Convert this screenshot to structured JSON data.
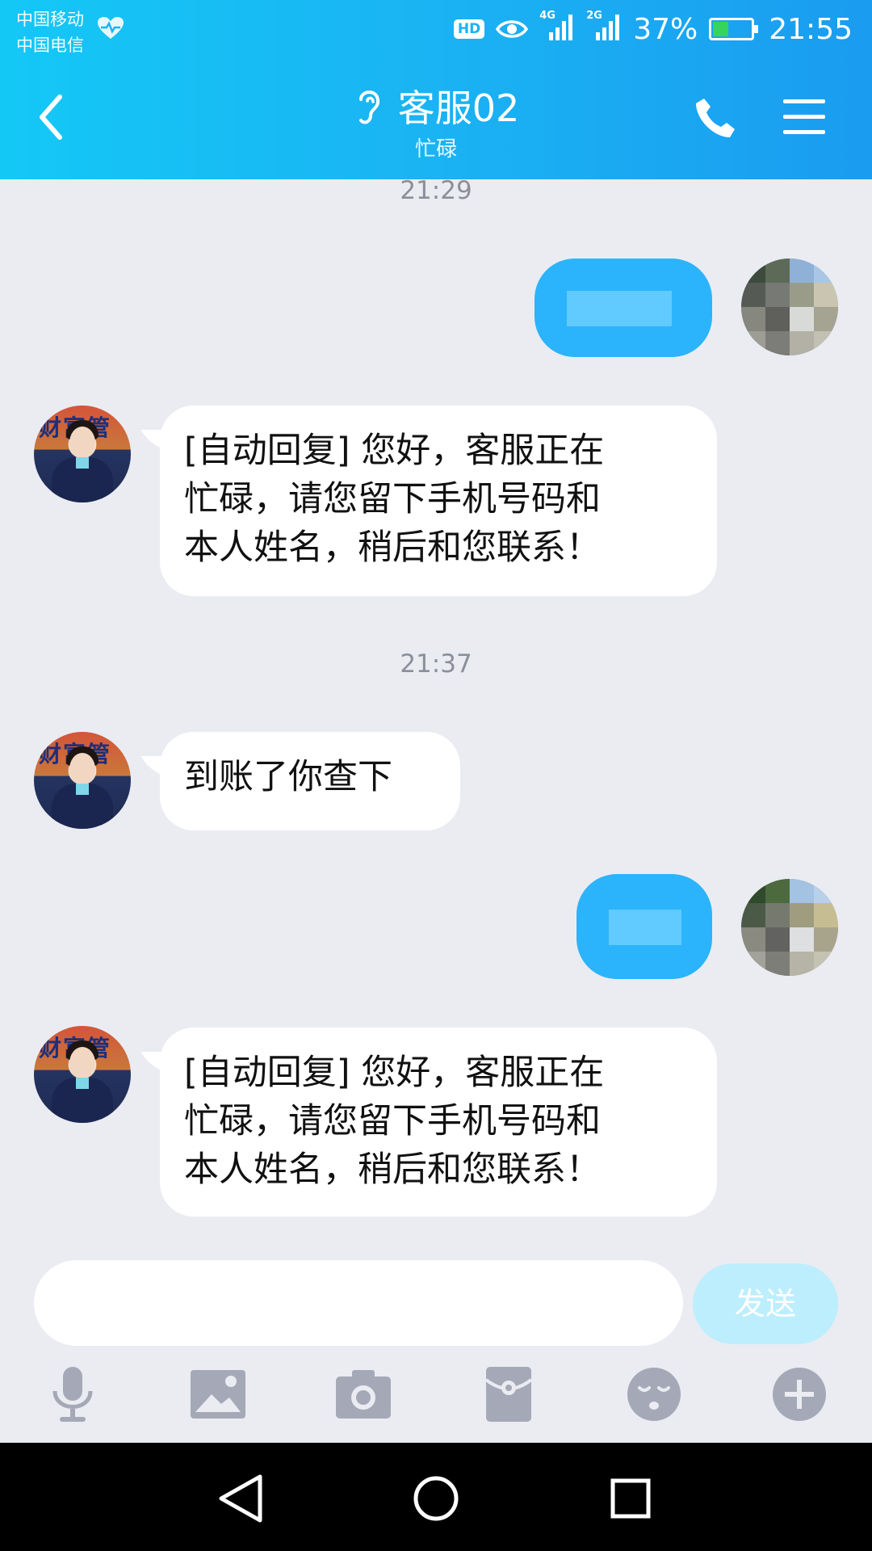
{
  "status_bar": {
    "carrier_1": "中国移动",
    "carrier_2": "中国电信",
    "hd": "HD",
    "net_1": "4G",
    "net_2": "2G",
    "battery": "37%",
    "time": "21:55"
  },
  "header": {
    "title": "客服02",
    "subtitle": "忙碌"
  },
  "messages": [
    {
      "kind": "time",
      "text": "21:29"
    },
    {
      "kind": "outgoing",
      "text": ""
    },
    {
      "kind": "incoming",
      "text": "[自动回复] 您好，客服正在\n忙碌，请您留下手机号码和\n本人姓名，稍后和您联系！"
    },
    {
      "kind": "time",
      "text": "21:37"
    },
    {
      "kind": "incoming",
      "text": "到账了你查下"
    },
    {
      "kind": "outgoing",
      "text": ""
    },
    {
      "kind": "incoming",
      "text": "[自动回复] 您好，客服正在\n忙碌，请您留下手机号码和\n本人姓名，稍后和您联系！"
    }
  ],
  "agent_avatar_sign": "财富管",
  "composer": {
    "placeholder": "",
    "send_label": "发送"
  },
  "toolbar_icons": [
    "microphone-icon",
    "image-icon",
    "camera-icon",
    "red-packet-icon",
    "emoji-icon",
    "plus-icon"
  ],
  "colors": {
    "header_start": "#14c8f6",
    "header_end": "#1a9cf0",
    "outgoing_bubble": "#2bb4fb",
    "background": "#eaecf2",
    "send_button": "#bdeefd"
  }
}
